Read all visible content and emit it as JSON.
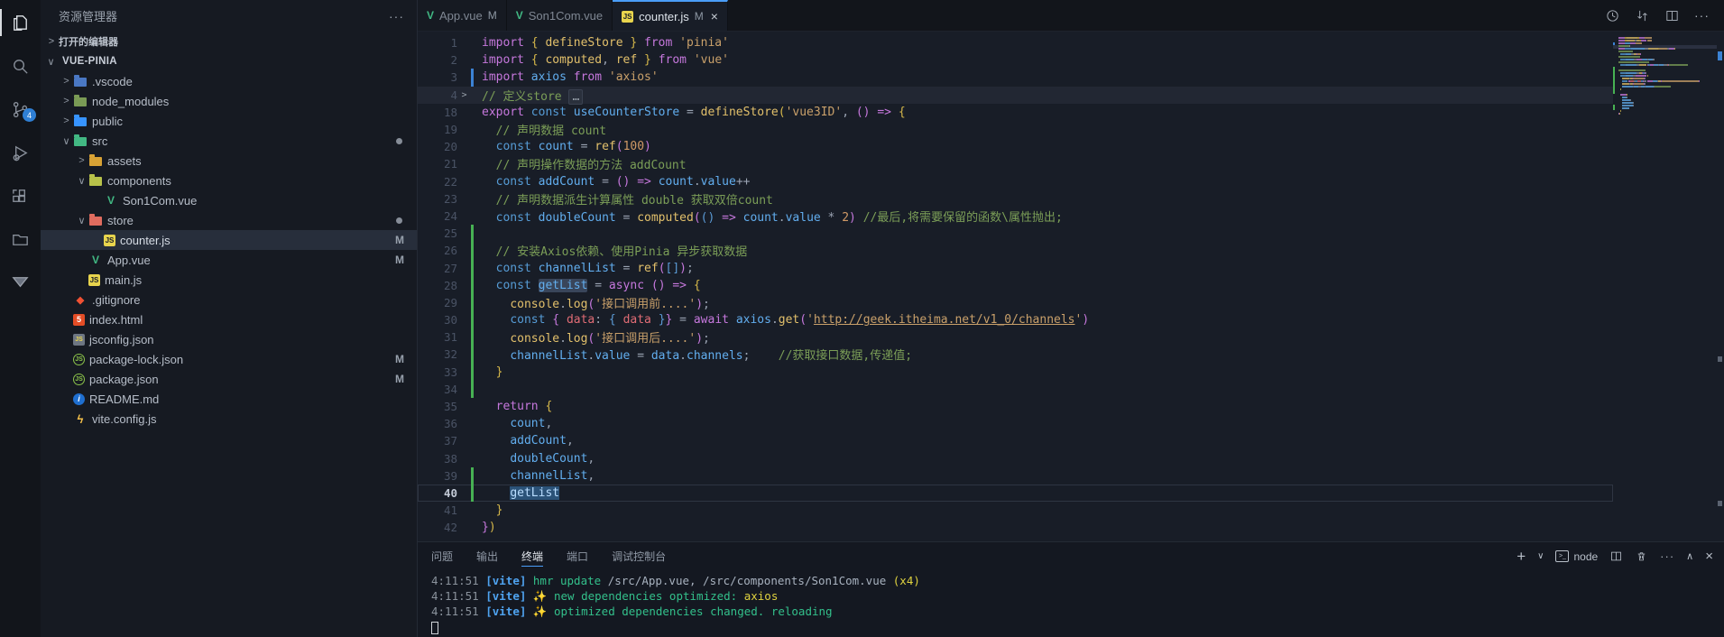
{
  "activity_bar": {
    "items": [
      {
        "name": "explorer",
        "active": true
      },
      {
        "name": "search"
      },
      {
        "name": "source-control",
        "badge": "4"
      },
      {
        "name": "run-debug"
      },
      {
        "name": "extensions"
      },
      {
        "name": "folder-view"
      },
      {
        "name": "filter"
      }
    ]
  },
  "sidebar": {
    "title": "资源管理器",
    "more_label": "···",
    "open_editors": "打开的编辑器",
    "tree": [
      {
        "label": "VUE-PINIA",
        "depth": 0,
        "chevron": "v",
        "root": true
      },
      {
        "label": ".vscode",
        "depth": 1,
        "chevron": ">",
        "icon": "folder",
        "color": "#4a78c4"
      },
      {
        "label": "node_modules",
        "depth": 1,
        "chevron": ">",
        "icon": "folder",
        "color": "#7a9b55"
      },
      {
        "label": "public",
        "depth": 1,
        "chevron": ">",
        "icon": "folder",
        "color": "#3794ff"
      },
      {
        "label": "src",
        "depth": 1,
        "chevron": "v",
        "icon": "folder",
        "color": "#42b883",
        "badge": "dot"
      },
      {
        "label": "assets",
        "depth": 2,
        "chevron": ">",
        "icon": "folder",
        "color": "#d8a235"
      },
      {
        "label": "components",
        "depth": 2,
        "chevron": "v",
        "icon": "folder",
        "color": "#b8c24a"
      },
      {
        "label": "Son1Com.vue",
        "depth": 3,
        "icon": "vue"
      },
      {
        "label": "store",
        "depth": 2,
        "chevron": "v",
        "icon": "folder",
        "color": "#e06c5f",
        "badge": "dot"
      },
      {
        "label": "counter.js",
        "depth": 3,
        "icon": "js",
        "selected": true,
        "badge": "M"
      },
      {
        "label": "App.vue",
        "depth": 2,
        "icon": "vue",
        "badge": "M"
      },
      {
        "label": "main.js",
        "depth": 2,
        "icon": "js"
      },
      {
        "label": ".gitignore",
        "depth": 1,
        "icon": "git"
      },
      {
        "label": "index.html",
        "depth": 1,
        "icon": "html"
      },
      {
        "label": "jsconfig.json",
        "depth": 1,
        "icon": "jsconfig"
      },
      {
        "label": "package-lock.json",
        "depth": 1,
        "icon": "npm",
        "badge": "M"
      },
      {
        "label": "package.json",
        "depth": 1,
        "icon": "npm",
        "badge": "M"
      },
      {
        "label": "README.md",
        "depth": 1,
        "icon": "info"
      },
      {
        "label": "vite.config.js",
        "depth": 1,
        "icon": "vite"
      }
    ]
  },
  "tabs": [
    {
      "label": "App.vue",
      "icon": "vue",
      "badge": "M"
    },
    {
      "label": "Son1Com.vue",
      "icon": "vue"
    },
    {
      "label": "counter.js",
      "icon": "js",
      "badge": "M",
      "active": true,
      "close": "×"
    }
  ],
  "editor_actions": {
    "more": "···"
  },
  "editor": {
    "lines": [
      {
        "n": "1",
        "seg": [
          {
            "t": "import ",
            "c": "kw"
          },
          {
            "t": "{ ",
            "c": "b1"
          },
          {
            "t": "defineStore",
            "c": "fn"
          },
          {
            "t": " }",
            "c": "b1"
          },
          {
            "t": " from ",
            "c": "kw"
          },
          {
            "t": "'pinia'",
            "c": "str"
          }
        ]
      },
      {
        "n": "2",
        "seg": [
          {
            "t": "import ",
            "c": "kw"
          },
          {
            "t": "{ ",
            "c": "b1"
          },
          {
            "t": "computed",
            "c": "fn"
          },
          {
            "t": ", ",
            "c": "pun"
          },
          {
            "t": "ref",
            "c": "fn"
          },
          {
            "t": " }",
            "c": "b1"
          },
          {
            "t": " from ",
            "c": "kw"
          },
          {
            "t": "'vue'",
            "c": "str"
          }
        ]
      },
      {
        "n": "3",
        "g": "m",
        "seg": [
          {
            "t": "import ",
            "c": "kw"
          },
          {
            "t": "axios",
            "c": "var"
          },
          {
            "t": " from ",
            "c": "kw"
          },
          {
            "t": "'axios'",
            "c": "str"
          }
        ]
      },
      {
        "n": "4",
        "fold": ">",
        "band": true,
        "seg": [
          {
            "t": "// 定义store ",
            "c": "cmt"
          },
          {
            "t": "…",
            "c": "fold"
          }
        ]
      },
      {
        "n": "18",
        "seg": [
          {
            "t": "export ",
            "c": "kw"
          },
          {
            "t": "const ",
            "c": "cst"
          },
          {
            "t": "useCounterStore",
            "c": "var"
          },
          {
            "t": " = ",
            "c": "pun"
          },
          {
            "t": "defineStore",
            "c": "fn"
          },
          {
            "t": "(",
            "c": "b1"
          },
          {
            "t": "'vue3ID'",
            "c": "str"
          },
          {
            "t": ", ",
            "c": "pun"
          },
          {
            "t": "()",
            "c": "b2"
          },
          {
            "t": " => ",
            "c": "kw"
          },
          {
            "t": "{",
            "c": "b1"
          }
        ]
      },
      {
        "n": "19",
        "seg": [
          {
            "t": "  // 声明数据 count",
            "c": "cmt"
          }
        ]
      },
      {
        "n": "20",
        "seg": [
          {
            "t": "  ",
            "c": "pun"
          },
          {
            "t": "const ",
            "c": "cst"
          },
          {
            "t": "count",
            "c": "var"
          },
          {
            "t": " = ",
            "c": "pun"
          },
          {
            "t": "ref",
            "c": "fn"
          },
          {
            "t": "(",
            "c": "b2"
          },
          {
            "t": "100",
            "c": "num"
          },
          {
            "t": ")",
            "c": "b2"
          }
        ]
      },
      {
        "n": "21",
        "seg": [
          {
            "t": "  // 声明操作数据的方法 addCount",
            "c": "cmt"
          }
        ]
      },
      {
        "n": "22",
        "seg": [
          {
            "t": "  ",
            "c": "pun"
          },
          {
            "t": "const ",
            "c": "cst"
          },
          {
            "t": "addCount",
            "c": "var"
          },
          {
            "t": " = ",
            "c": "pun"
          },
          {
            "t": "()",
            "c": "b2"
          },
          {
            "t": " => ",
            "c": "kw"
          },
          {
            "t": "count",
            "c": "var"
          },
          {
            "t": ".",
            "c": "pun"
          },
          {
            "t": "value",
            "c": "var"
          },
          {
            "t": "++",
            "c": "pun"
          }
        ]
      },
      {
        "n": "23",
        "seg": [
          {
            "t": "  // 声明数据派生计算属性 double 获取双倍count",
            "c": "cmt"
          }
        ]
      },
      {
        "n": "24",
        "seg": [
          {
            "t": "  ",
            "c": "pun"
          },
          {
            "t": "const ",
            "c": "cst"
          },
          {
            "t": "doubleCount",
            "c": "var"
          },
          {
            "t": " = ",
            "c": "pun"
          },
          {
            "t": "computed",
            "c": "fn"
          },
          {
            "t": "(",
            "c": "b2"
          },
          {
            "t": "()",
            "c": "b3"
          },
          {
            "t": " => ",
            "c": "kw"
          },
          {
            "t": "count",
            "c": "var"
          },
          {
            "t": ".",
            "c": "pun"
          },
          {
            "t": "value",
            "c": "var"
          },
          {
            "t": " * ",
            "c": "pun"
          },
          {
            "t": "2",
            "c": "num"
          },
          {
            "t": ")",
            "c": "b2"
          },
          {
            "t": " //最后,将需要保留的函数\\属性抛出;",
            "c": "cmt"
          }
        ]
      },
      {
        "n": "25",
        "g": "a",
        "seg": []
      },
      {
        "n": "26",
        "g": "a",
        "seg": [
          {
            "t": "  // 安装Axios依赖、使用Pinia 异步获取数据",
            "c": "cmt"
          }
        ]
      },
      {
        "n": "27",
        "g": "a",
        "seg": [
          {
            "t": "  ",
            "c": "pun"
          },
          {
            "t": "const ",
            "c": "cst"
          },
          {
            "t": "channelList",
            "c": "var"
          },
          {
            "t": " = ",
            "c": "pun"
          },
          {
            "t": "ref",
            "c": "fn"
          },
          {
            "t": "(",
            "c": "b2"
          },
          {
            "t": "[]",
            "c": "b3"
          },
          {
            "t": ")",
            "c": "b2"
          },
          {
            "t": ";",
            "c": "pun"
          }
        ]
      },
      {
        "n": "28",
        "g": "a",
        "seg": [
          {
            "t": "  ",
            "c": "pun"
          },
          {
            "t": "const ",
            "c": "cst"
          },
          {
            "t": "getList",
            "c": "varw"
          },
          {
            "t": " = ",
            "c": "pun"
          },
          {
            "t": "async ",
            "c": "kw"
          },
          {
            "t": "()",
            "c": "b2"
          },
          {
            "t": " => ",
            "c": "kw"
          },
          {
            "t": "{",
            "c": "b1"
          }
        ]
      },
      {
        "n": "29",
        "g": "a",
        "seg": [
          {
            "t": "    ",
            "c": "pun"
          },
          {
            "t": "console",
            "c": "fn"
          },
          {
            "t": ".",
            "c": "pun"
          },
          {
            "t": "log",
            "c": "fn"
          },
          {
            "t": "(",
            "c": "b2"
          },
          {
            "t": "'接口调用前....'",
            "c": "str"
          },
          {
            "t": ")",
            "c": "b2"
          },
          {
            "t": ";",
            "c": "pun"
          }
        ]
      },
      {
        "n": "30",
        "g": "a",
        "seg": [
          {
            "t": "    ",
            "c": "pun"
          },
          {
            "t": "const ",
            "c": "cst"
          },
          {
            "t": "{ ",
            "c": "b2"
          },
          {
            "t": "data",
            "c": "red"
          },
          {
            "t": ": ",
            "c": "pun"
          },
          {
            "t": "{ ",
            "c": "b3"
          },
          {
            "t": "data",
            "c": "red"
          },
          {
            "t": " }",
            "c": "b3"
          },
          {
            "t": "}",
            "c": "b2"
          },
          {
            "t": " = ",
            "c": "pun"
          },
          {
            "t": "await ",
            "c": "kw"
          },
          {
            "t": "axios",
            "c": "var"
          },
          {
            "t": ".",
            "c": "pun"
          },
          {
            "t": "get",
            "c": "fn"
          },
          {
            "t": "(",
            "c": "b2"
          },
          {
            "t": "'",
            "c": "str"
          },
          {
            "t": "http://geek.itheima.net/v1_0/channels",
            "c": "link"
          },
          {
            "t": "'",
            "c": "str"
          },
          {
            "t": ")",
            "c": "b2"
          }
        ]
      },
      {
        "n": "31",
        "g": "a",
        "seg": [
          {
            "t": "    ",
            "c": "pun"
          },
          {
            "t": "console",
            "c": "fn"
          },
          {
            "t": ".",
            "c": "pun"
          },
          {
            "t": "log",
            "c": "fn"
          },
          {
            "t": "(",
            "c": "b2"
          },
          {
            "t": "'接口调用后....'",
            "c": "str"
          },
          {
            "t": ")",
            "c": "b2"
          },
          {
            "t": ";",
            "c": "pun"
          }
        ]
      },
      {
        "n": "32",
        "g": "a",
        "seg": [
          {
            "t": "    ",
            "c": "pun"
          },
          {
            "t": "channelList",
            "c": "var"
          },
          {
            "t": ".",
            "c": "pun"
          },
          {
            "t": "value",
            "c": "var"
          },
          {
            "t": " = ",
            "c": "pun"
          },
          {
            "t": "data",
            "c": "var"
          },
          {
            "t": ".",
            "c": "pun"
          },
          {
            "t": "channels",
            "c": "var"
          },
          {
            "t": ";",
            "c": "pun"
          },
          {
            "t": "    //获取接口数据,传递值;",
            "c": "cmt"
          }
        ]
      },
      {
        "n": "33",
        "g": "a",
        "seg": [
          {
            "t": "  ",
            "c": "pun"
          },
          {
            "t": "}",
            "c": "b1"
          }
        ]
      },
      {
        "n": "34",
        "g": "a",
        "seg": []
      },
      {
        "n": "35",
        "seg": [
          {
            "t": "  ",
            "c": "pun"
          },
          {
            "t": "return ",
            "c": "kw"
          },
          {
            "t": "{",
            "c": "b1"
          }
        ]
      },
      {
        "n": "36",
        "seg": [
          {
            "t": "    ",
            "c": "pun"
          },
          {
            "t": "count",
            "c": "var"
          },
          {
            "t": ",",
            "c": "pun"
          }
        ]
      },
      {
        "n": "37",
        "seg": [
          {
            "t": "    ",
            "c": "pun"
          },
          {
            "t": "addCount",
            "c": "var"
          },
          {
            "t": ",",
            "c": "pun"
          }
        ]
      },
      {
        "n": "38",
        "seg": [
          {
            "t": "    ",
            "c": "pun"
          },
          {
            "t": "doubleCount",
            "c": "var"
          },
          {
            "t": ",",
            "c": "pun"
          }
        ]
      },
      {
        "n": "39",
        "g": "a",
        "seg": [
          {
            "t": "    ",
            "c": "pun"
          },
          {
            "t": "channelList",
            "c": "var"
          },
          {
            "t": ",",
            "c": "pun"
          }
        ]
      },
      {
        "n": "40",
        "g": "a",
        "cur": true,
        "seg": [
          {
            "t": "    ",
            "c": "pun"
          },
          {
            "t": "getList",
            "c": "vars"
          }
        ]
      },
      {
        "n": "41",
        "seg": [
          {
            "t": "  ",
            "c": "pun"
          },
          {
            "t": "}",
            "c": "b1"
          }
        ]
      },
      {
        "n": "42",
        "seg": [
          {
            "t": "}",
            "c": "b2"
          },
          {
            "t": ")",
            "c": "b1"
          }
        ]
      }
    ]
  },
  "panel": {
    "tabs": [
      {
        "label": "问题"
      },
      {
        "label": "输出"
      },
      {
        "label": "终端",
        "active": true
      },
      {
        "label": "端口"
      },
      {
        "label": "调试控制台"
      }
    ],
    "actions": {
      "new": "+",
      "dropdown": "∨",
      "shell_label": "node",
      "more": "···",
      "maximize": "∧",
      "close": "×"
    },
    "terminal_lines": [
      [
        {
          "t": "4:11:51 ",
          "c": "dim"
        },
        {
          "t": "[vite] ",
          "c": "blue"
        },
        {
          "t": "hmr update ",
          "c": "green"
        },
        {
          "t": "/src/App.vue, /src/components/Son1Com.vue ",
          "c": "path"
        },
        {
          "t": "(x4)",
          "c": "yel"
        }
      ],
      [
        {
          "t": "4:11:51 ",
          "c": "dim"
        },
        {
          "t": "[vite] ",
          "c": "blue"
        },
        {
          "t": "✨ ",
          "c": "yel"
        },
        {
          "t": "new dependencies optimized: ",
          "c": "green"
        },
        {
          "t": "axios",
          "c": "yel"
        }
      ],
      [
        {
          "t": "4:11:51 ",
          "c": "dim"
        },
        {
          "t": "[vite] ",
          "c": "blue"
        },
        {
          "t": "✨ ",
          "c": "yel"
        },
        {
          "t": "optimized dependencies changed. reloading",
          "c": "green"
        }
      ]
    ]
  }
}
